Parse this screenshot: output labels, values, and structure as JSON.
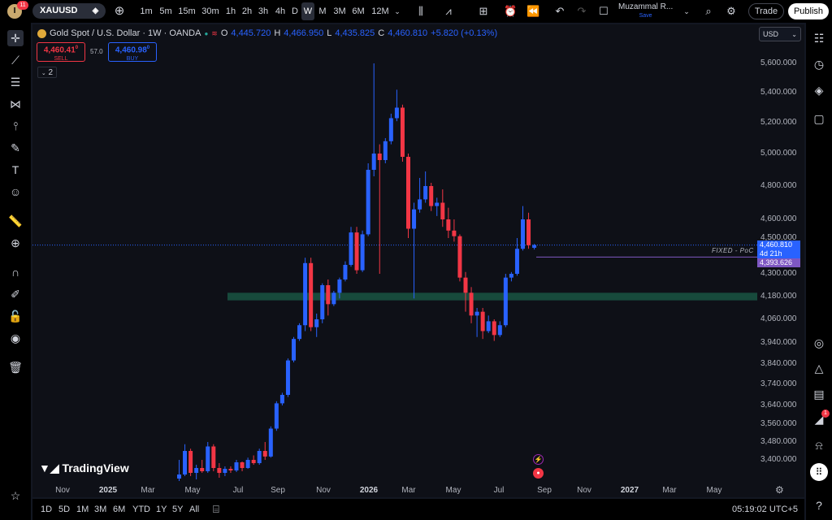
{
  "topbar": {
    "avatar_letter": "I",
    "notification_count": "11",
    "symbol": "XAUUSD",
    "timeframes": [
      "1m",
      "5m",
      "15m",
      "30m",
      "1h",
      "2h",
      "3h",
      "4h",
      "D",
      "W",
      "M",
      "3M",
      "6M",
      "12M"
    ],
    "active_timeframe": "W",
    "user_name": "Muzammal R...",
    "user_sub": "Save",
    "trade_label": "Trade",
    "publish_label": "Publish"
  },
  "legend": {
    "title": "Gold Spot / U.S. Dollar · 1W · OANDA",
    "o_label": "O",
    "o_value": "4,445.720",
    "h_label": "H",
    "h_value": "4,466.950",
    "l_label": "L",
    "l_value": "4,435.825",
    "c_label": "C",
    "c_value": "4,460.810",
    "change": "+5.820 (+0.13%)"
  },
  "trade": {
    "sell_price": "4,460.41",
    "sell_sup": "0",
    "sell_label": "SELL",
    "spread": "57.0",
    "buy_price": "4,460.98",
    "buy_sup": "0",
    "buy_label": "BUY"
  },
  "indicators_count": "2",
  "currency": "USD",
  "y_axis": [
    "5,600.000",
    "5,400.000",
    "5,200.000",
    "5,000.000",
    "4,800.000",
    "4,600.000",
    "4,500.000",
    "4,300.000",
    "4,180.000",
    "4,060.000",
    "3,940.000",
    "3,840.000",
    "3,740.000",
    "3,640.000",
    "3,560.000",
    "3,480.000",
    "3,400.000"
  ],
  "x_axis": [
    {
      "label": "Nov",
      "bold": false
    },
    {
      "label": "2025",
      "bold": true
    },
    {
      "label": "Mar",
      "bold": false
    },
    {
      "label": "May",
      "bold": false
    },
    {
      "label": "Jul",
      "bold": false
    },
    {
      "label": "Sep",
      "bold": false
    },
    {
      "label": "Nov",
      "bold": false
    },
    {
      "label": "2026",
      "bold": true
    },
    {
      "label": "Mar",
      "bold": false
    },
    {
      "label": "May",
      "bold": false
    },
    {
      "label": "Jul",
      "bold": false
    },
    {
      "label": "Sep",
      "bold": false
    },
    {
      "label": "Nov",
      "bold": false
    },
    {
      "label": "2027",
      "bold": true
    },
    {
      "label": "Mar",
      "bold": false
    },
    {
      "label": "May",
      "bold": false
    }
  ],
  "price_tag": {
    "price": "4,460.810",
    "countdown": "4d 21h",
    "poc_price": "4,393.626",
    "poc_label": "FIXED - PoC"
  },
  "logo_text": "TradingView",
  "colors": {
    "up": "#2962ff",
    "down": "#f23645",
    "zone": "#1b5e4a",
    "poc": "#7e57c2",
    "accent": "#2962ff"
  },
  "bottombar": {
    "ranges": [
      "1D",
      "5D",
      "1M",
      "3M",
      "6M",
      "YTD",
      "1Y",
      "5Y",
      "All"
    ],
    "clock": "05:19:02 UTC+5"
  },
  "chart_data": {
    "type": "candlestick",
    "symbol": "XAUUSD",
    "interval": "1W",
    "ylim": [
      3300,
      5700
    ],
    "zone": [
      4160,
      4200
    ],
    "poc": 4393.626,
    "last": 4460.81,
    "candles": [
      [
        3285,
        3400,
        3270,
        3310
      ],
      [
        3310,
        3470,
        3300,
        3440
      ],
      [
        3440,
        3450,
        3300,
        3320
      ],
      [
        3320,
        3370,
        3280,
        3350
      ],
      [
        3350,
        3400,
        3320,
        3330
      ],
      [
        3330,
        3480,
        3320,
        3460
      ],
      [
        3460,
        3470,
        3330,
        3350
      ],
      [
        3350,
        3380,
        3290,
        3320
      ],
      [
        3320,
        3360,
        3300,
        3345
      ],
      [
        3345,
        3360,
        3320,
        3335
      ],
      [
        3335,
        3400,
        3325,
        3385
      ],
      [
        3385,
        3390,
        3330,
        3350
      ],
      [
        3350,
        3410,
        3345,
        3400
      ],
      [
        3400,
        3420,
        3370,
        3380
      ],
      [
        3380,
        3450,
        3370,
        3440
      ],
      [
        3440,
        3480,
        3400,
        3415
      ],
      [
        3415,
        3550,
        3410,
        3540
      ],
      [
        3540,
        3660,
        3530,
        3650
      ],
      [
        3650,
        3700,
        3640,
        3690
      ],
      [
        3690,
        3860,
        3680,
        3850
      ],
      [
        3850,
        3970,
        3840,
        3960
      ],
      [
        3960,
        4040,
        3950,
        4030
      ],
      [
        4030,
        4390,
        4000,
        4360
      ],
      [
        4360,
        4390,
        4000,
        4020
      ],
      [
        4020,
        4090,
        3970,
        4060
      ],
      [
        4060,
        4250,
        4040,
        4240
      ],
      [
        4240,
        4270,
        4080,
        4140
      ],
      [
        4140,
        4210,
        4130,
        4200
      ],
      [
        4200,
        4280,
        4170,
        4270
      ],
      [
        4270,
        4370,
        4260,
        4350
      ],
      [
        4350,
        4560,
        4340,
        4530
      ],
      [
        4530,
        4560,
        4300,
        4320
      ],
      [
        4320,
        4540,
        4310,
        4520
      ],
      [
        4520,
        4940,
        4510,
        4900
      ],
      [
        4900,
        5600,
        4860,
        5000
      ],
      [
        5000,
        5060,
        4300,
        4960
      ],
      [
        4960,
        5100,
        4940,
        5080
      ],
      [
        5080,
        5260,
        5060,
        5230
      ],
      [
        5230,
        5420,
        5210,
        5300
      ],
      [
        5300,
        5320,
        4950,
        4980
      ],
      [
        4980,
        5000,
        4500,
        4550
      ],
      [
        4550,
        4700,
        4170,
        4660
      ],
      [
        4660,
        4850,
        4640,
        4720
      ],
      [
        4720,
        4890,
        4700,
        4800
      ],
      [
        4800,
        4820,
        4650,
        4680
      ],
      [
        4680,
        4730,
        4620,
        4700
      ],
      [
        4700,
        4780,
        4560,
        4600
      ],
      [
        4600,
        4670,
        4500,
        4540
      ],
      [
        4540,
        4600,
        4480,
        4510
      ],
      [
        4510,
        4520,
        4260,
        4280
      ],
      [
        4280,
        4310,
        4100,
        4200
      ],
      [
        4200,
        4230,
        4040,
        4080
      ],
      [
        4080,
        4120,
        3970,
        4100
      ],
      [
        4100,
        4120,
        3960,
        4000
      ],
      [
        4000,
        4080,
        3990,
        4050
      ],
      [
        4050,
        4060,
        3950,
        3980
      ],
      [
        3980,
        4050,
        3970,
        4030
      ],
      [
        4030,
        4300,
        4020,
        4280
      ],
      [
        4280,
        4310,
        4260,
        4300
      ],
      [
        4300,
        4500,
        4290,
        4440
      ],
      [
        4440,
        4680,
        4430,
        4600
      ],
      [
        4600,
        4640,
        4440,
        4460
      ],
      [
        4445.72,
        4466.95,
        4435.825,
        4460.81
      ]
    ]
  }
}
